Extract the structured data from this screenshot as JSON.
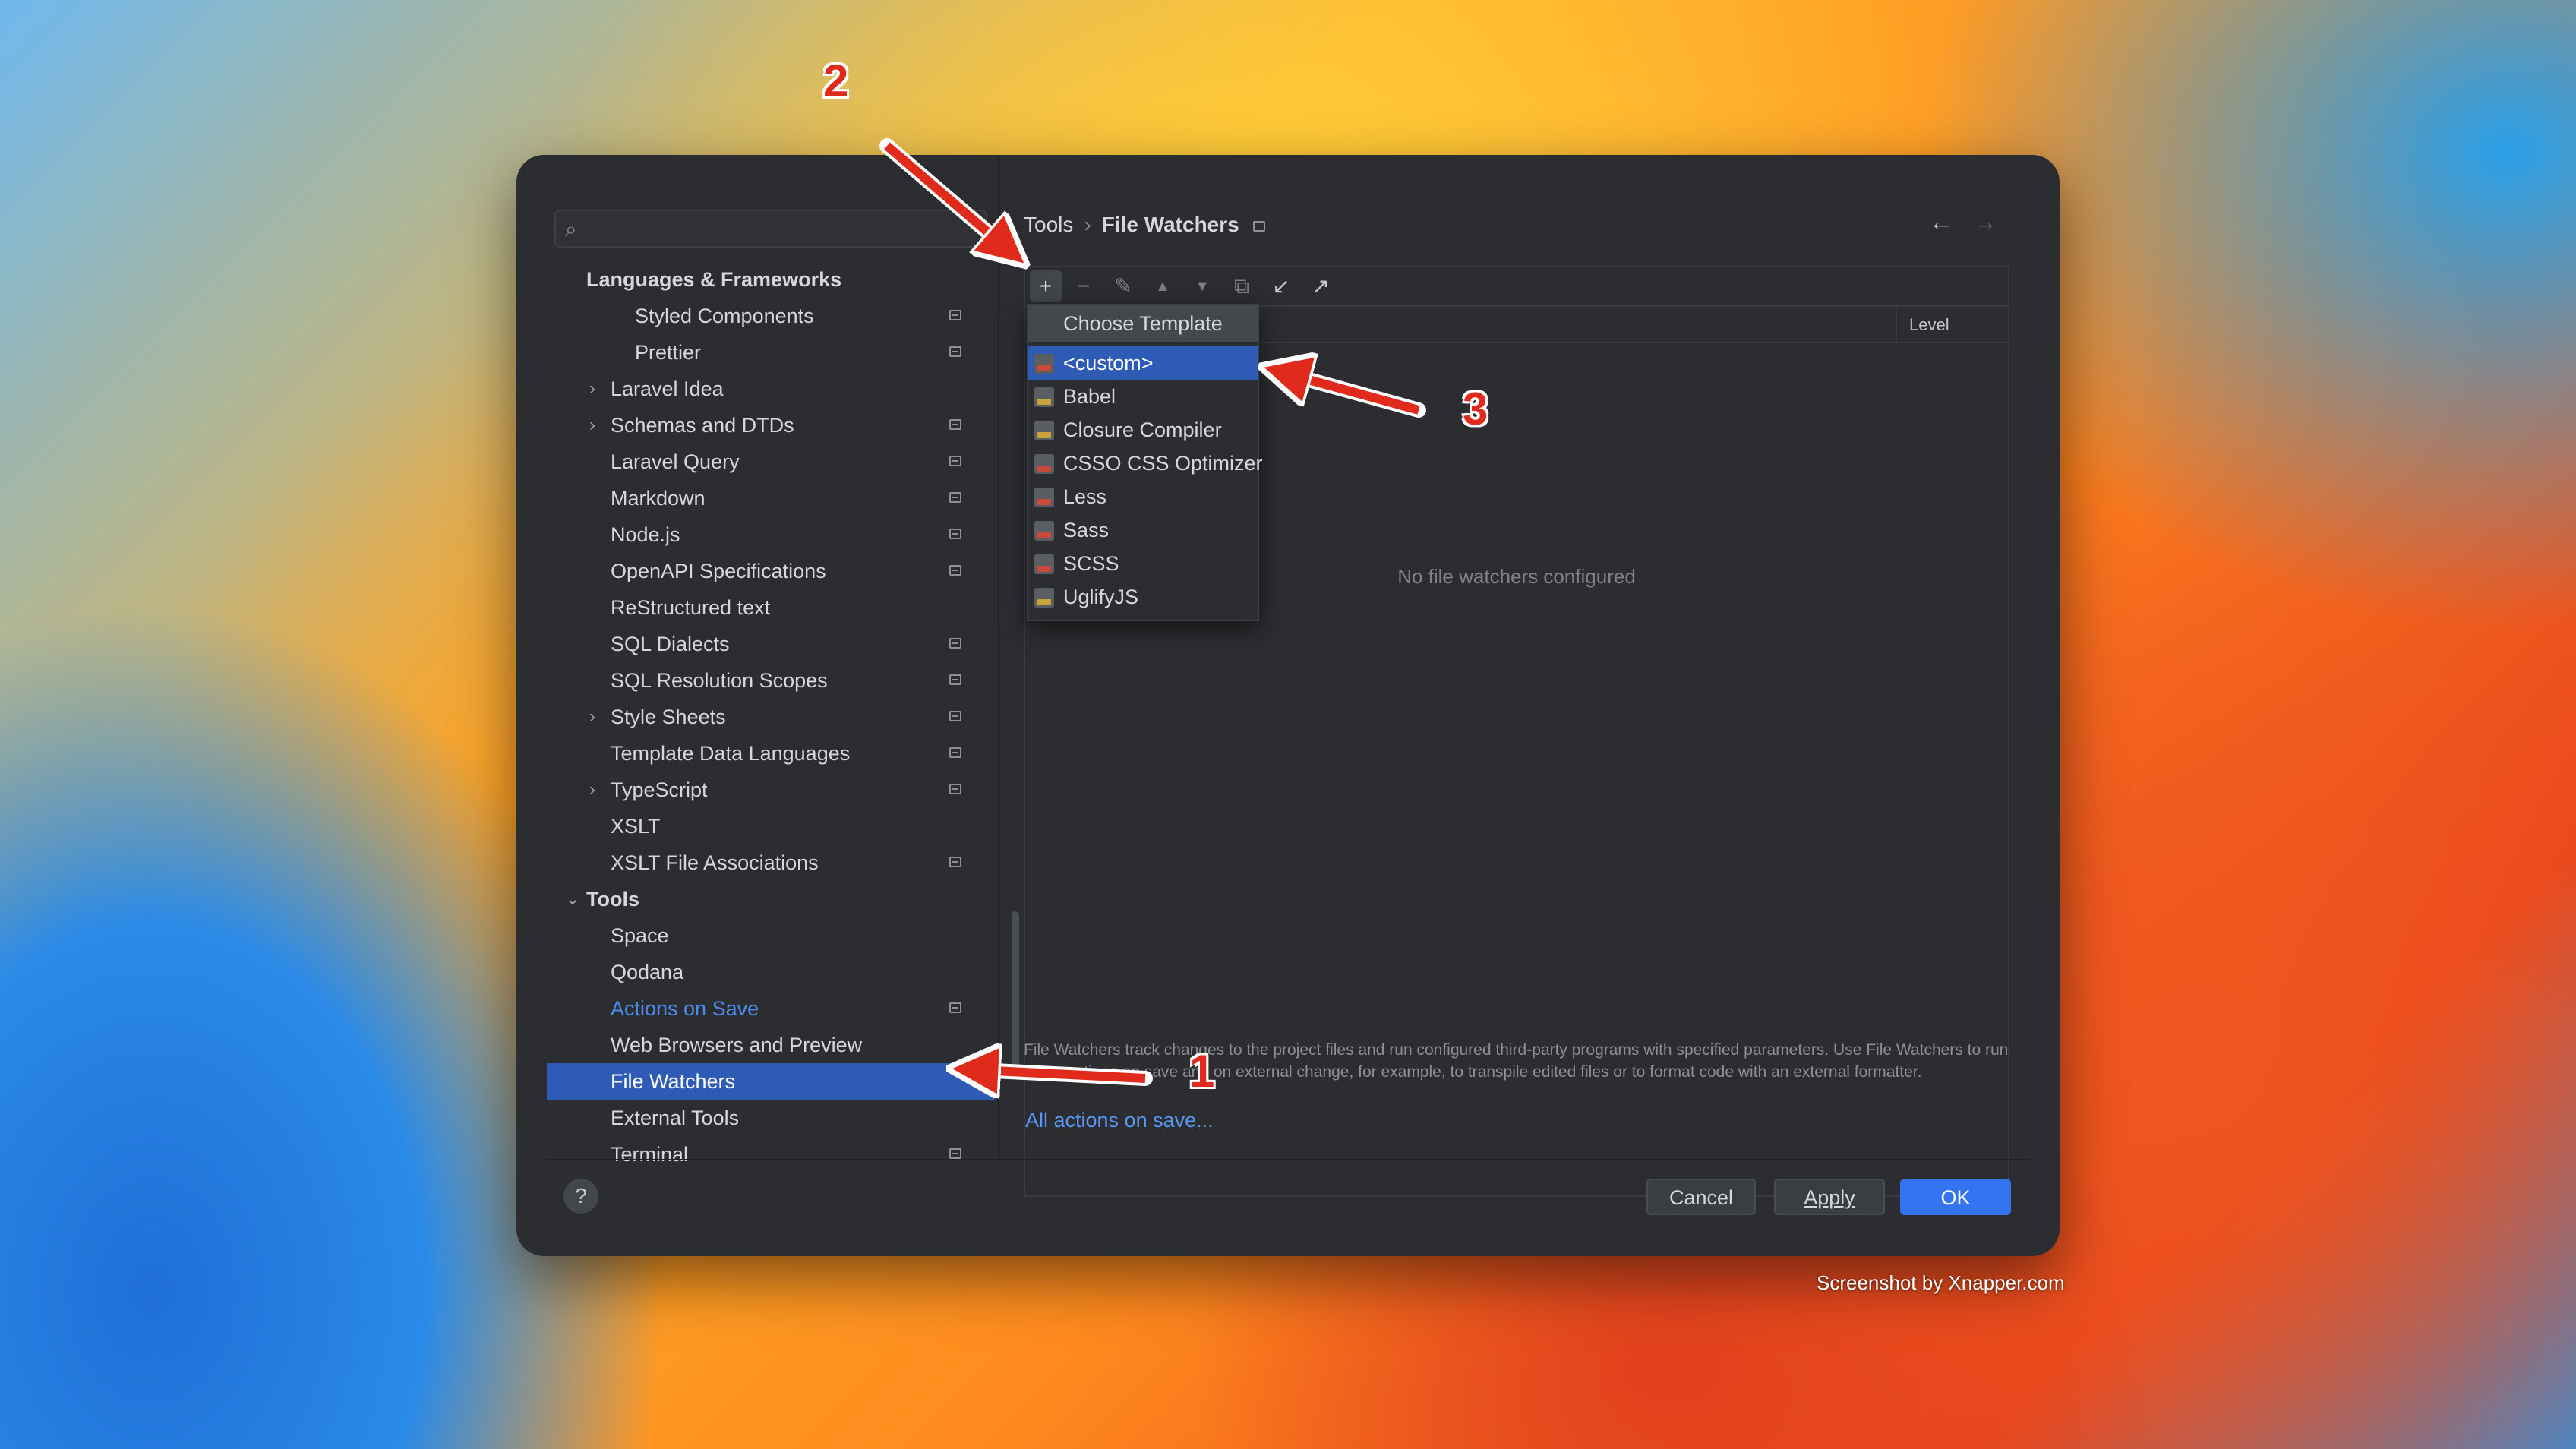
{
  "sidebar": {
    "search_placeholder": "",
    "items": [
      {
        "label": "Languages & Frameworks",
        "bold": true,
        "level": 0,
        "chevron": "",
        "pinned": false
      },
      {
        "label": "Styled Components",
        "level": 2,
        "chevron": "",
        "pinned": true
      },
      {
        "label": "Prettier",
        "level": 2,
        "chevron": "",
        "pinned": true
      },
      {
        "label": "Laravel Idea",
        "level": 1,
        "chevron": "›",
        "pinned": false
      },
      {
        "label": "Schemas and DTDs",
        "level": 1,
        "chevron": "›",
        "pinned": true
      },
      {
        "label": "Laravel Query",
        "level": 1,
        "chevron": "",
        "pinned": true
      },
      {
        "label": "Markdown",
        "level": 1,
        "chevron": "",
        "pinned": true
      },
      {
        "label": "Node.js",
        "level": 1,
        "chevron": "",
        "pinned": true
      },
      {
        "label": "OpenAPI Specifications",
        "level": 1,
        "chevron": "",
        "pinned": true
      },
      {
        "label": "ReStructured text",
        "level": 1,
        "chevron": "",
        "pinned": false
      },
      {
        "label": "SQL Dialects",
        "level": 1,
        "chevron": "",
        "pinned": true
      },
      {
        "label": "SQL Resolution Scopes",
        "level": 1,
        "chevron": "",
        "pinned": true
      },
      {
        "label": "Style Sheets",
        "level": 1,
        "chevron": "›",
        "pinned": true
      },
      {
        "label": "Template Data Languages",
        "level": 1,
        "chevron": "",
        "pinned": true
      },
      {
        "label": "TypeScript",
        "level": 1,
        "chevron": "›",
        "pinned": true
      },
      {
        "label": "XSLT",
        "level": 1,
        "chevron": "",
        "pinned": false
      },
      {
        "label": "XSLT File Associations",
        "level": 1,
        "chevron": "",
        "pinned": true
      },
      {
        "label": "Tools",
        "bold": true,
        "level": 0,
        "chevron": "⌄",
        "pinned": false
      },
      {
        "label": "Space",
        "level": 1,
        "chevron": "",
        "pinned": false
      },
      {
        "label": "Qodana",
        "level": 1,
        "chevron": "",
        "pinned": false
      },
      {
        "label": "Actions on Save",
        "level": 1,
        "chevron": "",
        "pinned": true,
        "link": true
      },
      {
        "label": "Web Browsers and Preview",
        "level": 1,
        "chevron": "",
        "pinned": false
      },
      {
        "label": "File Watchers",
        "level": 1,
        "chevron": "",
        "pinned": false,
        "selected": true
      },
      {
        "label": "External Tools",
        "level": 1,
        "chevron": "",
        "pinned": false
      },
      {
        "label": "Terminal",
        "level": 1,
        "chevron": "",
        "pinned": true
      }
    ]
  },
  "breadcrumb": {
    "parent": "Tools",
    "separator": "›",
    "current": "File Watchers"
  },
  "nav": {
    "back": "←",
    "forward": "→"
  },
  "toolbar": {
    "add": "+",
    "remove": "−",
    "edit": "✎",
    "up": "▲",
    "down": "▼",
    "copy": "⧉",
    "import": "↙",
    "export": "↗"
  },
  "table": {
    "level_header": "Level",
    "empty_text": "No file watchers configured"
  },
  "popup": {
    "title": "Choose Template",
    "items": [
      {
        "label": "<custom>",
        "selected": true,
        "icon": "custom-file-icon"
      },
      {
        "label": "Babel",
        "icon": "js-file-icon"
      },
      {
        "label": "Closure Compiler",
        "icon": "js-file-icon"
      },
      {
        "label": "CSSO CSS Optimizer",
        "icon": "css-file-icon"
      },
      {
        "label": "Less",
        "icon": "less-file-icon"
      },
      {
        "label": "Sass",
        "icon": "sass-file-icon"
      },
      {
        "label": "SCSS",
        "icon": "sass-file-icon"
      },
      {
        "label": "UglifyJS",
        "icon": "js-file-icon"
      }
    ]
  },
  "description": "File Watchers track changes to the project files and run configured third-party programs with specified parameters. Use File Watchers to run some actions on save and on external change, for example, to transpile edited files or to format code with an external formatter.",
  "all_actions_link": "All actions on save...",
  "buttons": {
    "help": "?",
    "cancel": "Cancel",
    "apply": "Apply",
    "ok": "OK"
  },
  "watermark": "Screenshot by Xnapper.com",
  "annotations": {
    "one": "1",
    "two": "2",
    "three": "3"
  },
  "colors": {
    "accent": "#3574f0",
    "selection": "#2e5bb5",
    "arrow": "#e02a1c"
  }
}
